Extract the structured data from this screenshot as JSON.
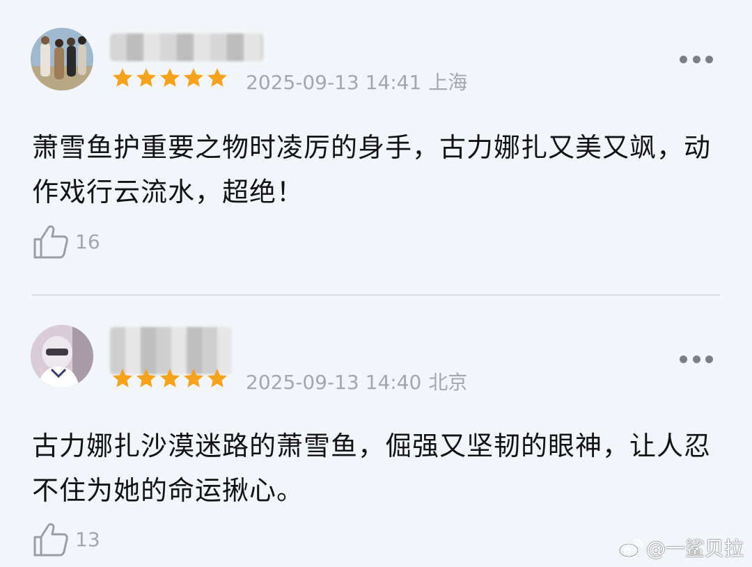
{
  "comments": [
    {
      "rating": 5,
      "time": "2025-09-13 14:41",
      "location": "上海",
      "content": "萧雪鱼护重要之物时凌厉的身手，古力娜扎又美又飒，动作戏行云流水，超绝！",
      "likes": "16"
    },
    {
      "rating": 5,
      "time": "2025-09-13 14:40",
      "location": "北京",
      "content": "古力娜扎沙漠迷路的萧雪鱼，倔强又坚韧的眼神，让人忍不住为她的命运揪心。",
      "likes": "13"
    }
  ],
  "watermark": {
    "text": "@一鲨贝拉"
  },
  "colors": {
    "star": "#f7a21b",
    "meta": "#a3a7ad",
    "background": "#f2f5f9"
  },
  "icons": [
    "more-icon",
    "thumbs-up-icon",
    "star-icon",
    "weibo-logo-icon"
  ]
}
